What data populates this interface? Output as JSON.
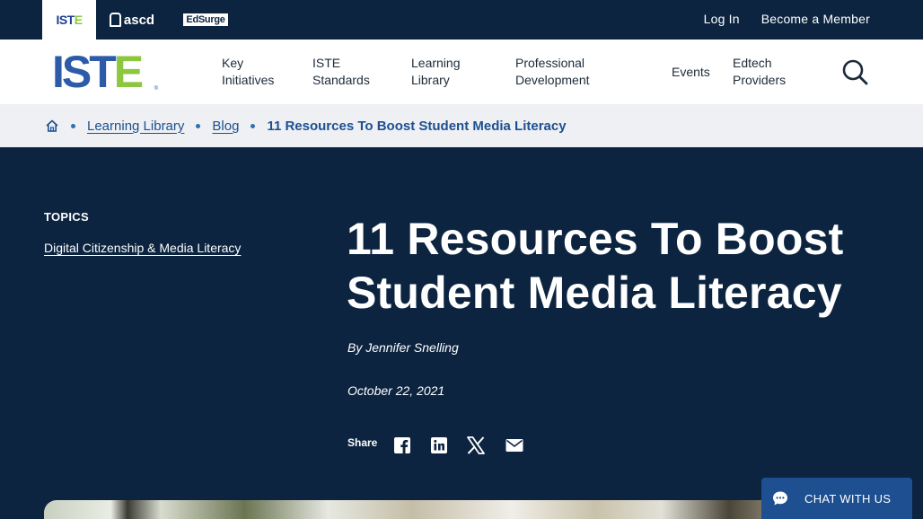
{
  "topbar": {
    "brands": [
      {
        "name": "ISTE",
        "label_main": "IST",
        "label_accent": "E"
      },
      {
        "name": "ascd",
        "label": "ascd"
      },
      {
        "name": "EdSurge",
        "label": "EdSurge"
      }
    ],
    "login_label": "Log In",
    "member_label": "Become a Member"
  },
  "logo": {
    "main": "IST",
    "accent": "E",
    "reg": "®"
  },
  "nav": {
    "items": [
      {
        "label": "Key\nInitiatives"
      },
      {
        "label": "ISTE\nStandards"
      },
      {
        "label": "Learning\nLibrary"
      },
      {
        "label": "Professional\nDevelopment"
      },
      {
        "label": "Events"
      },
      {
        "label": "Edtech\nProviders"
      }
    ],
    "search_icon": "search-icon"
  },
  "breadcrumb": {
    "home_icon": "home-icon",
    "items": [
      "Learning Library",
      "Blog"
    ],
    "current": "11 Resources To Boost Student Media Literacy"
  },
  "sidebar": {
    "topics_label": "TOPICS",
    "topic": "Digital Citizenship & Media Literacy"
  },
  "article": {
    "title": "11 Resources To Boost Student Media Literacy",
    "byline": "By Jennifer Snelling",
    "date": "October 22, 2021",
    "share_label": "Share",
    "share_icons": [
      "facebook-icon",
      "linkedin-icon",
      "x-icon",
      "email-icon"
    ]
  },
  "chat": {
    "label": "CHAT WITH US",
    "icon": "chat-icon"
  },
  "colors": {
    "navy": "#0c2440",
    "iste_blue": "#2e5ba8",
    "iste_green": "#8dc63f",
    "link_blue": "#1d4f91",
    "crumb_bg": "#eef0f3"
  }
}
